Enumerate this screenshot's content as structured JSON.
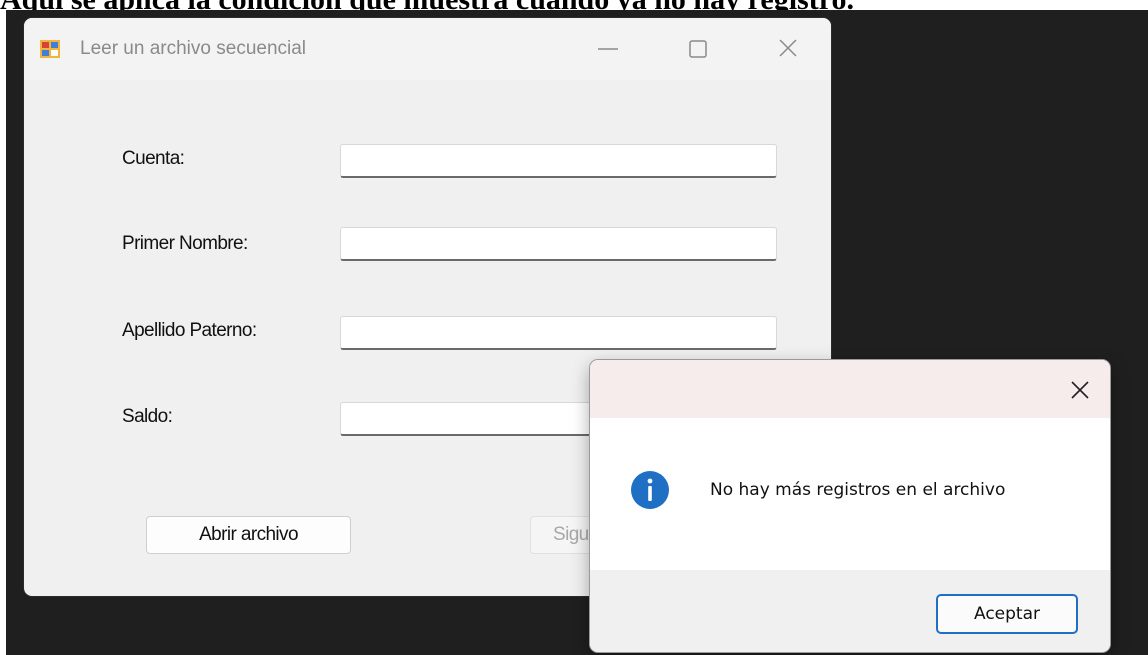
{
  "caption": "Aquí se aplica la condición que muestra cuando ya no hay registro.",
  "window": {
    "title": "Leer un archivo secuencial",
    "icon": "app-form-icon",
    "controls": [
      "minimize-icon",
      "maximize-icon",
      "close-icon"
    ]
  },
  "form": {
    "fields": [
      {
        "label": "Cuenta:",
        "value": ""
      },
      {
        "label": "Primer Nombre:",
        "value": ""
      },
      {
        "label": "Apellido Paterno:",
        "value": ""
      },
      {
        "label": "Saldo:",
        "value": ""
      }
    ],
    "open_button": "Abrir archivo",
    "next_button_visible": "Sigu"
  },
  "dialog": {
    "icon": "info-icon",
    "message": "No hay más registros en el archivo",
    "ok_button": "Aceptar",
    "accent": "#1f6fc5"
  }
}
